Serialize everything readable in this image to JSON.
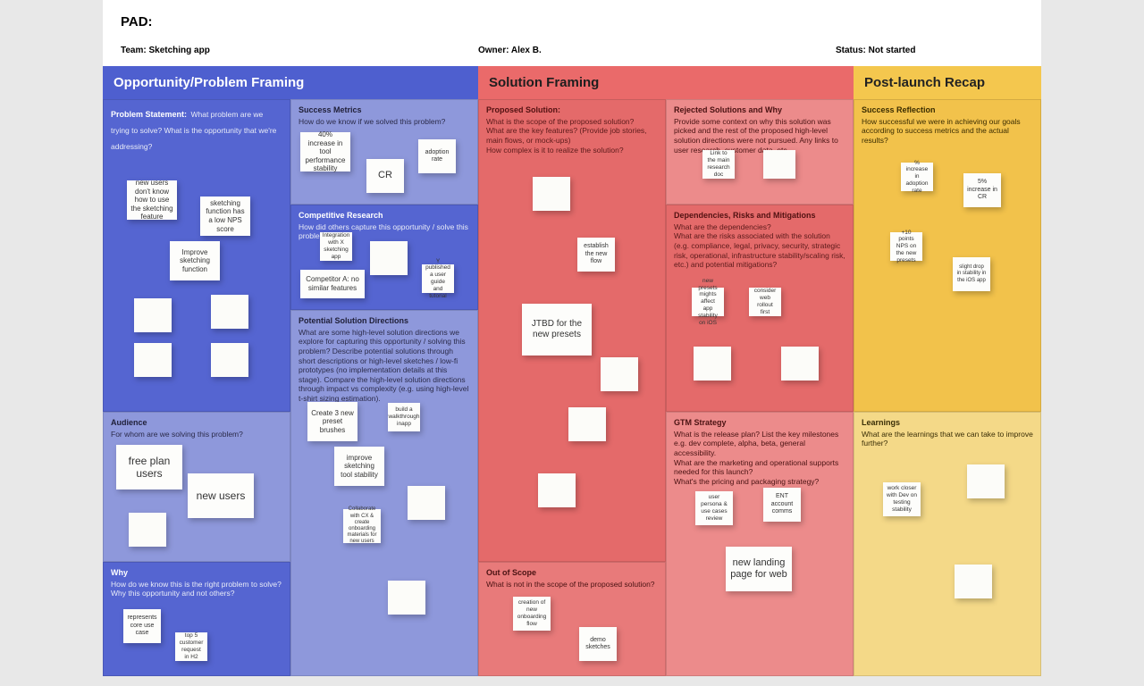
{
  "header": {
    "pad": "PAD:"
  },
  "meta": {
    "team": "Team: Sketching app",
    "owner": "Owner: Alex B.",
    "status": "Status: Not started"
  },
  "cols": {
    "opportunity": "Opportunity/Problem Framing",
    "solution": "Solution Framing",
    "recap": "Post-launch Recap"
  },
  "cells": {
    "problem": {
      "title": "Problem Statement:",
      "desc": "What problem are we trying to solve? What is the opportunity that we're addressing?"
    },
    "audience": {
      "title": "Audience",
      "desc": "For whom are we solving this problem?"
    },
    "why": {
      "title": "Why",
      "desc": "How do we know this is the right problem to solve? Why this opportunity and not others?"
    },
    "metrics": {
      "title": "Success Metrics",
      "desc": "How do we know if we solved this problem?"
    },
    "research": {
      "title": "Competitive Research",
      "desc": "How did others capture this opportunity / solve this problem?"
    },
    "directions": {
      "title": "Potential Solution Directions",
      "desc": "What are some high-level solution directions we explore for capturing this opportunity / solving this problem? Describe potential solutions through short descriptions or high-level sketches / low-fi prototypes (no implementation details at this stage). Compare the high-level solution directions through impact vs complexity (e.g. using high-level t-shirt sizing estimation)."
    },
    "proposed": {
      "title": "Proposed Solution:",
      "desc": "What is the scope of the proposed solution?\nWhat are the key features? (Provide job stories, main flows, or mock-ups)\nHow complex is it to realize the solution?"
    },
    "oos": {
      "title": "Out of Scope",
      "desc": "What is not in the scope of the proposed solution?"
    },
    "rejected": {
      "title": "Rejected Solutions and Why",
      "desc": "Provide some context on why this solution was picked and the rest of the proposed high-level solution directions were not pursued. Any links to user research, customer data, etc."
    },
    "deps": {
      "title": "Dependencies, Risks and Mitigations",
      "desc": "What are the dependencies?\nWhat are the risks associated with the solution (e.g. compliance, legal, privacy, security, strategic risk, operational, infrastructure stability/scaling risk, etc.) and potential mitigations?"
    },
    "gtm": {
      "title": "GTM Strategy",
      "desc": "What is the release plan? List the key milestones e.g. dev complete, alpha, beta, general accessibility.\nWhat are the marketing and operational supports needed for this launch?\nWhat's the pricing and packaging strategy?"
    },
    "success": {
      "title": "Success Reflection",
      "desc": "How successful we were in achieving our goals according to success metrics and the actual results?"
    },
    "learn": {
      "title": "Learnings",
      "desc": "What are the learnings that we can take to improve further?"
    }
  },
  "notes": {
    "problem": {
      "n1": "new users don't know how to use the sketching feature",
      "n2": "sketching function has a low NPS score",
      "n3": "Improve sketching function"
    },
    "audience": {
      "n1": "free plan users",
      "n2": "new users"
    },
    "why": {
      "n1": "represents core use case",
      "n2": "top 5 customer request in H2"
    },
    "metrics": {
      "n1": "40% increase in tool performance stability",
      "n2": "CR",
      "n3": "adoption rate"
    },
    "research": {
      "n1": "Integration with X sketching app",
      "n2": "Competitor A: no similar features",
      "n3": "Y published a user guide and tutorial"
    },
    "directions": {
      "n1": "Create 3 new preset brushes",
      "n2": "build a walkthrough inapp",
      "n3": "improve sketching tool stability",
      "n4": "Collaborate with CX & create onboarding materials for new users"
    },
    "proposed": {
      "n1": "establish the new flow",
      "n2": "JTBD for the new presets"
    },
    "oos": {
      "n1": "creation of new onboarding flow",
      "n2": "demo sketches"
    },
    "rejected": {
      "n1": "Link to the main research doc"
    },
    "deps": {
      "n1": "new presets mights affect app stability on iOS",
      "n2": "consider web rollout first"
    },
    "gtm": {
      "n1": "user persona & use cases review",
      "n2": "ENT account comms",
      "n3": "new landing page for web"
    },
    "success": {
      "n1": "% increase in adoption rate",
      "n2": "5% increase in CR",
      "n3": "+10 points NPS on the new presets",
      "n4": "slight drop in stability in the iOS app"
    },
    "learn": {
      "n1": "work closer with Dev on testing stability"
    }
  }
}
